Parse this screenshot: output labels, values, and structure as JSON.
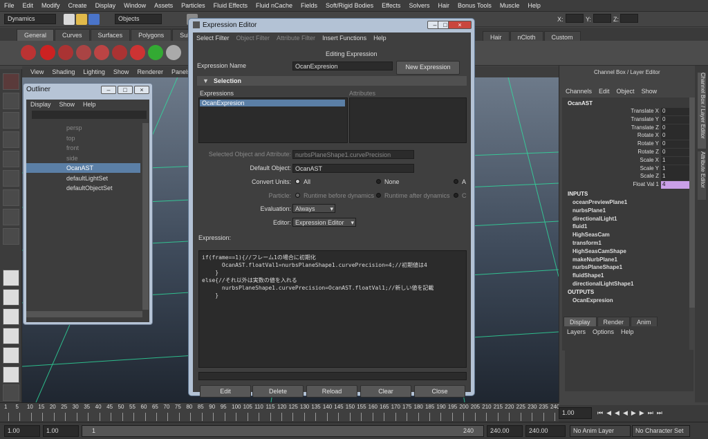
{
  "main_menu": [
    "File",
    "Edit",
    "Modify",
    "Create",
    "Display",
    "Window",
    "Assets",
    "Particles",
    "Fluid Effects",
    "Fluid nCache",
    "Fields",
    "Soft/Rigid Bodies",
    "Effects",
    "Solvers",
    "Hair",
    "Bonus Tools",
    "Muscle",
    "Help"
  ],
  "statusline": {
    "mode": "Dynamics",
    "objects_label": "Objects",
    "x": "X:",
    "y": "Y:",
    "z": "Z:"
  },
  "shelf_tabs": [
    "General",
    "Curves",
    "Surfaces",
    "Polygons",
    "Subdivs"
  ],
  "shelf_tabs_right": [
    "Hair",
    "nCloth",
    "Custom"
  ],
  "viewport_menu": [
    "View",
    "Shading",
    "Lighting",
    "Show",
    "Renderer",
    "Panels"
  ],
  "outliner": {
    "title": "Outliner",
    "menu": [
      "Display",
      "Show",
      "Help"
    ],
    "items": [
      {
        "label": "persp",
        "dim": true
      },
      {
        "label": "top",
        "dim": true
      },
      {
        "label": "front",
        "dim": true
      },
      {
        "label": "side",
        "dim": true
      },
      {
        "label": "OcanAST",
        "selected": true
      },
      {
        "label": "defaultLightSet"
      },
      {
        "label": "defaultObjectSet"
      }
    ]
  },
  "expression_editor": {
    "title": "Expression Editor",
    "menu": [
      "Select Filter",
      "Object Filter",
      "Attribute Filter",
      "Insert Functions",
      "Help"
    ],
    "heading": "Editing Expression",
    "name_label": "Expression Name",
    "name_value": "OcanExpresion",
    "new_button": "New Expression",
    "section": "Selection",
    "expressions_header": "Expressions",
    "attributes_header": "Attributes",
    "expression_item": "OcanExpresion",
    "sel_obj_label": "Selected Object and Attribute:",
    "sel_obj_value": "nurbsPlaneShape1.curvePrecision",
    "default_obj_label": "Default Object:",
    "default_obj_value": "OcanAST",
    "convert_label": "Convert Units:",
    "convert_all": "All",
    "convert_none": "None",
    "convert_a": "A",
    "particle_label": "Particle:",
    "particle_before": "Runtime before dynamics",
    "particle_after": "Runtime after dynamics",
    "particle_c": "C",
    "evaluation_label": "Evaluation:",
    "evaluation_value": "Always",
    "editor_label": "Editor:",
    "editor_value": "Expression Editor",
    "expression_label": "Expression:",
    "code": "if(frame==1){//フレーム1の場合に初期化\n      OcanAST.floatVal1=nurbsPlaneShape1.curvePrecision=4;//初期値は4\n    }\nelse{//それ以外は実数の値を入れる\n      nurbsPlaneShape1.curvePrecision=OcanAST.floatVal1;//新しい値を記載\n    }",
    "buttons": [
      "Edit",
      "Delete",
      "Reload",
      "Clear",
      "Close"
    ]
  },
  "channel_box": {
    "title": "Channel Box / Layer Editor",
    "menu": [
      "Channels",
      "Edit",
      "Object",
      "Show"
    ],
    "object": "OcanAST",
    "channels": [
      {
        "label": "Translate X",
        "value": "0"
      },
      {
        "label": "Translate Y",
        "value": "0"
      },
      {
        "label": "Translate Z",
        "value": "0"
      },
      {
        "label": "Rotate X",
        "value": "0"
      },
      {
        "label": "Rotate Y",
        "value": "0"
      },
      {
        "label": "Rotate Z",
        "value": "0"
      },
      {
        "label": "Scale X",
        "value": "1"
      },
      {
        "label": "Scale Y",
        "value": "1"
      },
      {
        "label": "Scale Z",
        "value": "1"
      },
      {
        "label": "Float Val 1",
        "value": "4"
      }
    ],
    "inputs_label": "INPUTS",
    "inputs": [
      "oceanPreviewPlane1",
      "nurbsPlane1",
      "directionalLight1",
      "fluid1",
      "HighSeasCam",
      "transform1",
      "HighSeasCamShape",
      "makeNurbPlane1",
      "nurbsPlaneShape1",
      "fluidShape1",
      "directionalLightShape1"
    ],
    "outputs_label": "OUTPUTS",
    "outputs": [
      "OcanExpresion"
    ],
    "layer_tabs": [
      "Display",
      "Render",
      "Anim"
    ],
    "layer_menu": [
      "Layers",
      "Options",
      "Help"
    ],
    "side_tabs": [
      "Channel Box / Layer Editor",
      "Attribute Editor"
    ]
  },
  "timeline": {
    "ticks": [
      "1",
      "5",
      "10",
      "15",
      "20",
      "25",
      "30",
      "35",
      "40",
      "45",
      "50",
      "55",
      "60",
      "65",
      "70",
      "75",
      "80",
      "85",
      "90",
      "95",
      "100",
      "105",
      "110",
      "115",
      "120",
      "125",
      "130",
      "135",
      "140",
      "145",
      "150",
      "155",
      "160",
      "165",
      "170",
      "175",
      "180",
      "185",
      "190",
      "195",
      "200",
      "205",
      "210",
      "215",
      "220",
      "225",
      "230",
      "235",
      "240"
    ],
    "current": "1.00"
  },
  "range": {
    "start": "1.00",
    "start2": "1.00",
    "slider_start": "1",
    "slider_end": "240",
    "end": "240.00",
    "end2": "240.00",
    "anim_layer": "No Anim Layer",
    "char_set": "No Character Set"
  }
}
